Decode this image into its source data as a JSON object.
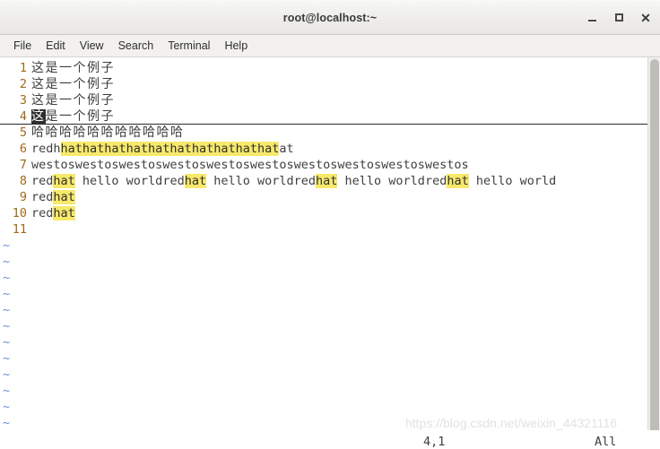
{
  "window": {
    "title": "root@localhost:~",
    "buttons": {
      "minimize": "minimize",
      "maximize": "maximize",
      "close": "✕"
    }
  },
  "menubar": {
    "items": [
      {
        "label": "File"
      },
      {
        "label": "Edit"
      },
      {
        "label": "View"
      },
      {
        "label": "Search"
      },
      {
        "label": "Terminal"
      },
      {
        "label": "Help"
      }
    ]
  },
  "editor": {
    "cursor_char": "这",
    "lines": [
      {
        "number": "1",
        "kind": "cjk",
        "segments": [
          {
            "text": "这是一个例子",
            "style": "plain"
          }
        ]
      },
      {
        "number": "2",
        "kind": "cjk",
        "segments": [
          {
            "text": "这是一个例子",
            "style": "plain"
          }
        ]
      },
      {
        "number": "3",
        "kind": "cjk",
        "segments": [
          {
            "text": "这是一个例子",
            "style": "plain"
          }
        ]
      },
      {
        "number": "4",
        "kind": "cjk",
        "cursorline": true,
        "segments": [
          {
            "text": "这",
            "style": "cursor"
          },
          {
            "text": "是一个例子",
            "style": "plain"
          }
        ]
      },
      {
        "number": "5",
        "kind": "cjk",
        "segments": [
          {
            "text": "哈哈哈哈哈哈哈哈哈哈哈",
            "style": "plain"
          }
        ]
      },
      {
        "number": "6",
        "kind": "code",
        "segments": [
          {
            "text": "redh",
            "style": "plain"
          },
          {
            "text": "hathathathathathathathathathat",
            "style": "highlight"
          },
          {
            "text": "at",
            "style": "plain"
          }
        ]
      },
      {
        "number": "7",
        "kind": "code",
        "segments": [
          {
            "text": "westoswestoswestoswestoswestoswestoswestoswestoswestoswestos",
            "style": "plain"
          }
        ]
      },
      {
        "number": "8",
        "kind": "code",
        "segments": [
          {
            "text": "red",
            "style": "plain"
          },
          {
            "text": "hat",
            "style": "highlight"
          },
          {
            "text": " hello worldred",
            "style": "plain"
          },
          {
            "text": "hat",
            "style": "highlight"
          },
          {
            "text": " hello worldred",
            "style": "plain"
          },
          {
            "text": "hat",
            "style": "highlight"
          },
          {
            "text": " hello worldred",
            "style": "plain"
          },
          {
            "text": "hat",
            "style": "highlight"
          },
          {
            "text": " hello world",
            "style": "plain"
          }
        ]
      },
      {
        "number": "9",
        "kind": "code",
        "segments": [
          {
            "text": "red",
            "style": "plain"
          },
          {
            "text": "hat",
            "style": "highlight"
          }
        ]
      },
      {
        "number": "10",
        "kind": "code",
        "segments": [
          {
            "text": "red",
            "style": "plain"
          },
          {
            "text": "hat",
            "style": "highlight"
          }
        ]
      },
      {
        "number": "11",
        "kind": "code",
        "segments": []
      }
    ],
    "empty_marker": "~",
    "empty_marker_count": 13
  },
  "statusbar": {
    "position": "4,1",
    "scroll": "All"
  },
  "watermark": {
    "text": "https://blog.csdn.net/weixin_44321116"
  },
  "colors": {
    "highlight": "#f7e96a",
    "line_number": "#a06a19",
    "tilde": "#6a8fd0",
    "text": "#3f3f3f",
    "cursor_bg": "#2f2f2f"
  }
}
